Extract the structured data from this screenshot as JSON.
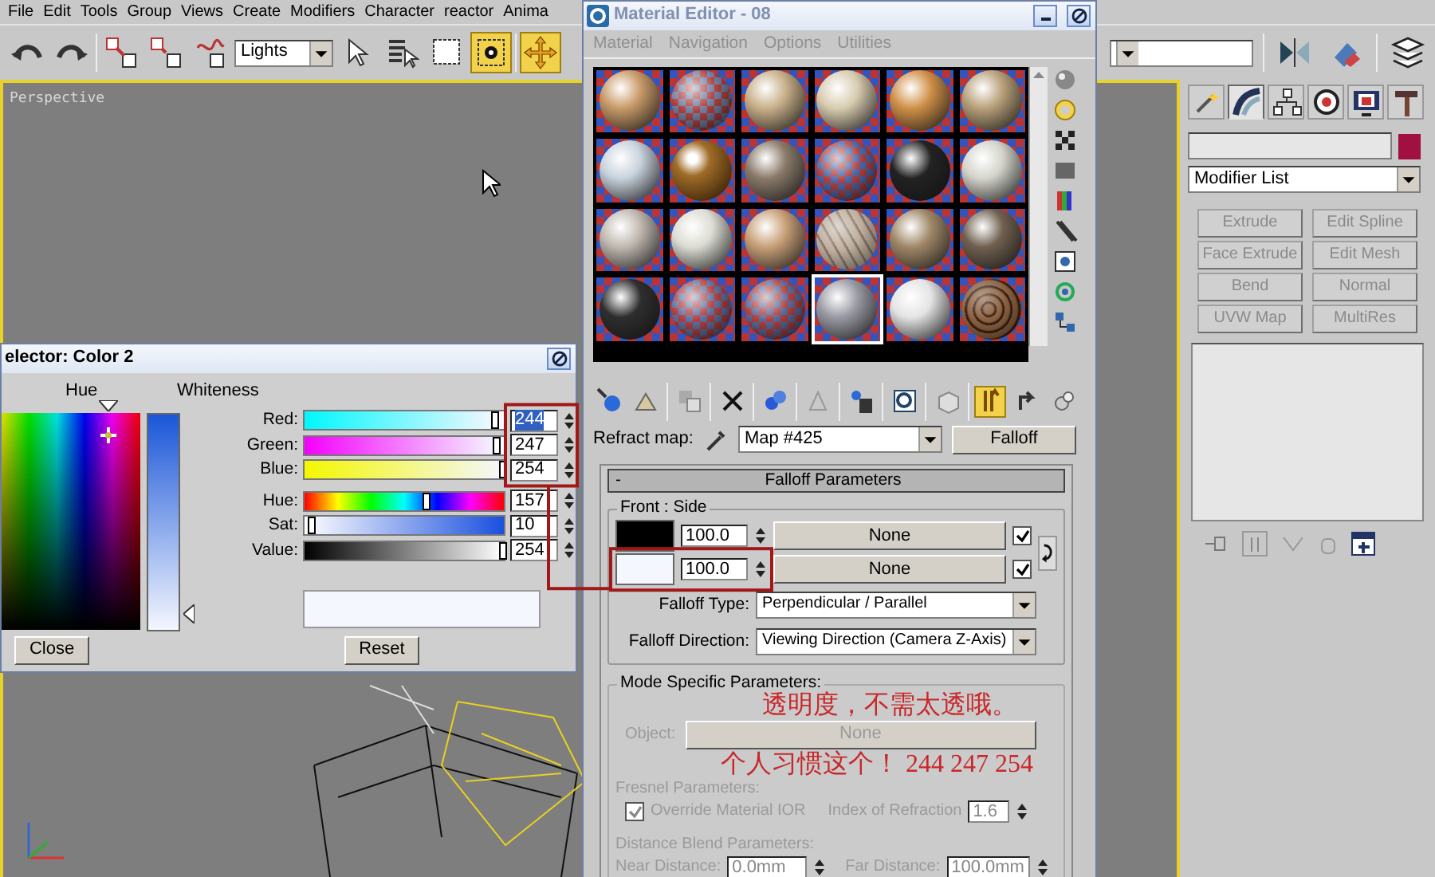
{
  "menu_bar": {
    "items": [
      "File",
      "Edit",
      "Tools",
      "Group",
      "Views",
      "Create",
      "Modifiers",
      "Character",
      "reactor",
      "Anima"
    ]
  },
  "main_toolbar": {
    "selection_filter": "Lights",
    "window_crossing_active": true,
    "move_active": true
  },
  "viewport": {
    "label": "Perspective",
    "active": true
  },
  "color_selector": {
    "title": "elector: Color 2",
    "hue_label": "Hue",
    "whiteness_label": "Whiteness",
    "channels": [
      {
        "label": "Red:",
        "value": "244",
        "level": 0.957,
        "annotated": true,
        "text_selected": true
      },
      {
        "label": "Green:",
        "value": "247",
        "level": 0.969,
        "annotated": true,
        "text_selected": false
      },
      {
        "label": "Blue:",
        "value": "254",
        "level": 0.996,
        "annotated": true,
        "text_selected": false
      },
      {
        "label": "Hue:",
        "value": "157",
        "level": 0.616,
        "annotated": false,
        "text_selected": false
      },
      {
        "label": "Sat:",
        "value": "10",
        "level": 0.039,
        "annotated": false,
        "text_selected": false
      },
      {
        "label": "Value:",
        "value": "254",
        "level": 0.996,
        "annotated": false,
        "text_selected": false
      }
    ],
    "swatch": {
      "color": "#f4f7fe"
    },
    "close_button": "Close",
    "reset_button": "Reset"
  },
  "material_editor": {
    "title": "Material Editor - 08",
    "menu": [
      "Material",
      "Navigation",
      "Options",
      "Utilities"
    ],
    "sample_slots": [
      {
        "kind": "smooth",
        "color": "#c89a68",
        "selected": false
      },
      {
        "kind": "checker",
        "color": "#7080a0",
        "selected": false
      },
      {
        "kind": "smooth",
        "color": "#c8b08a",
        "selected": false
      },
      {
        "kind": "smooth",
        "color": "#d8ccb0",
        "selected": false
      },
      {
        "kind": "smooth",
        "color": "#d09048",
        "selected": false
      },
      {
        "kind": "smooth",
        "color": "#b8a07a",
        "selected": false
      },
      {
        "kind": "smooth",
        "color": "#c8d2dc",
        "selected": false
      },
      {
        "kind": "shiny",
        "color": "#a06c28",
        "selected": false
      },
      {
        "kind": "smooth",
        "color": "#8a7a6a",
        "selected": false
      },
      {
        "kind": "checker",
        "color": "#4a68a8",
        "selected": false
      },
      {
        "kind": "smooth",
        "color": "#222222",
        "selected": false
      },
      {
        "kind": "smooth",
        "color": "#d4d4cc",
        "selected": false
      },
      {
        "kind": "smooth",
        "color": "#c0b8b0",
        "selected": false
      },
      {
        "kind": "smooth",
        "color": "#dcdcd4",
        "selected": false
      },
      {
        "kind": "smooth",
        "color": "#c8a078",
        "selected": false
      },
      {
        "kind": "marble",
        "color": "#c0b0a0",
        "selected": false
      },
      {
        "kind": "smooth",
        "color": "#a08868",
        "selected": false
      },
      {
        "kind": "smooth",
        "color": "#706050",
        "selected": false
      },
      {
        "kind": "smooth",
        "color": "#2e2e2e",
        "selected": false
      },
      {
        "kind": "checker",
        "color": "#6070a0",
        "selected": false
      },
      {
        "kind": "checker",
        "color": "#5a6a9a",
        "selected": false
      },
      {
        "kind": "smooth",
        "color": "#9a9aa4",
        "selected": true
      },
      {
        "kind": "smooth",
        "color": "#e4e4e4",
        "selected": false
      },
      {
        "kind": "wood",
        "color": "#8a6040",
        "selected": false
      }
    ],
    "show_end_result_active": true,
    "map_label": "Refract map:",
    "map_name": "Map #425",
    "map_type_button": "Falloff",
    "rollout": {
      "toggle": "-",
      "title": "Falloff Parameters",
      "front_side": {
        "label": "Front : Side",
        "rows": [
          {
            "color": "#000000",
            "amount": "100.0",
            "map": "None",
            "checked": true,
            "annotated": false
          },
          {
            "color": "#f4f7fe",
            "amount": "100.0",
            "map": "None",
            "checked": true,
            "annotated": true
          }
        ]
      },
      "falloff_type_label": "Falloff Type:",
      "falloff_type": "Perpendicular / Parallel",
      "falloff_direction_label": "Falloff Direction:",
      "falloff_direction": "Viewing Direction (Camera Z-Axis)",
      "mode_specific": {
        "label": "Mode Specific Parameters:",
        "disabled": true,
        "object_label": "Object:",
        "object_button": "None",
        "fresnel_label": "Fresnel Parameters:",
        "override_ior": {
          "label": "Override Material IOR",
          "checked": true
        },
        "ior_label": "Index of Refraction",
        "ior_value": "1.6",
        "distance_label": "Distance Blend Parameters:",
        "near_label": "Near Distance:",
        "near_value": "0.0mm",
        "far_label": "Far Distance:",
        "far_value": "100.0mm"
      }
    }
  },
  "annotations": [
    "透明度，不需太透哦。",
    "个人习惯这个！ 244 247 254"
  ],
  "command_panel": {
    "tabs": [
      {
        "selected": false
      },
      {
        "selected": true
      },
      {
        "selected": false
      },
      {
        "selected": false
      },
      {
        "selected": false
      },
      {
        "selected": false
      }
    ],
    "object_swatch": {
      "color": "#a01040"
    },
    "modifier_list": "Modifier List",
    "modifier_buttons": [
      "Extrude",
      "Edit Spline",
      "Face Extrude",
      "Edit Mesh",
      "Bend",
      "Normal",
      "UVW Map",
      "MultiRes"
    ]
  }
}
